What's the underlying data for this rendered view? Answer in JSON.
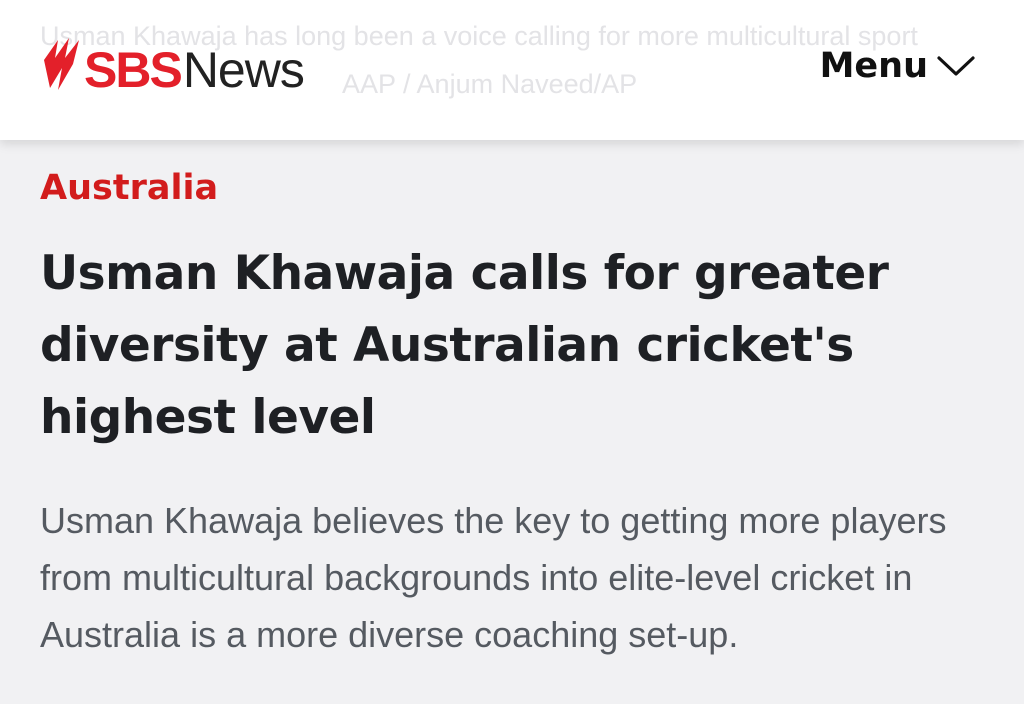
{
  "header": {
    "background_caption_line1": "Usman Khawaja has long been a voice calling for more multicultural sport",
    "background_caption_line2": "AAP / Anjum Naveed/AP",
    "logo_text_sbs": "SBS",
    "logo_text_news": "News",
    "menu_label": "Menu",
    "brand_color": "#e3202a"
  },
  "article": {
    "category": "Australia",
    "category_color": "#d21c1c",
    "headline": "Usman Khawaja calls for greater diversity at Australian cricket's highest level",
    "summary": "Usman Khawaja believes the key to getting more players from multicultural backgrounds into elite-level cricket in Australia is a more diverse coaching set-up."
  },
  "icons": {
    "logo": "sbs-logo-icon",
    "menu": "chevron-down-icon"
  }
}
